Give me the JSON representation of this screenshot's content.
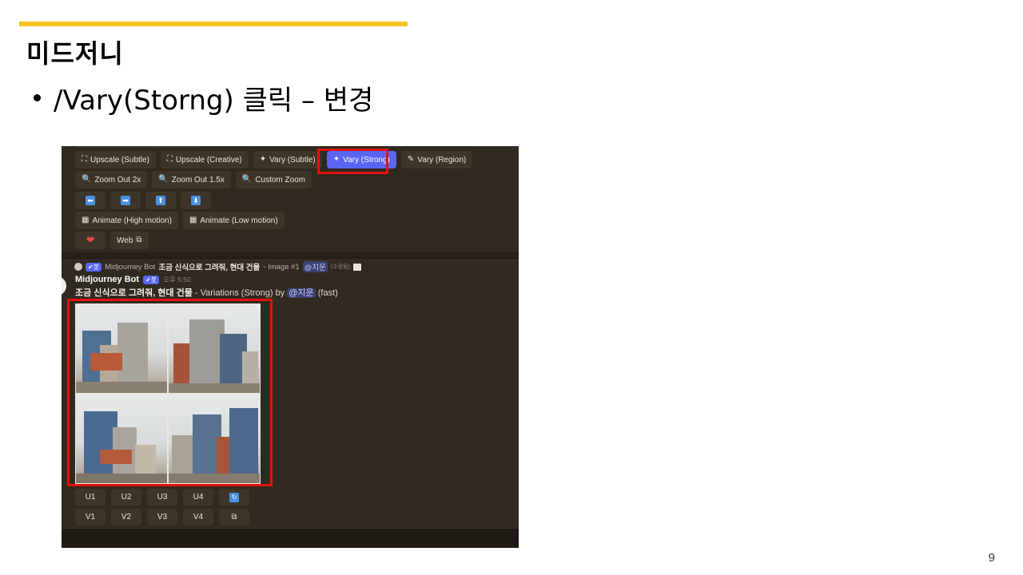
{
  "slide": {
    "title": "미드저니",
    "bullet": "/Vary(Storng) 클릭 – 변경",
    "page_number": "9",
    "accent_color": "#f7c51e"
  },
  "discord": {
    "action_buttons_row1": [
      {
        "icon": "expand-icon",
        "label": "Upscale (Subtle)"
      },
      {
        "icon": "expand-icon",
        "label": "Upscale (Creative)"
      },
      {
        "icon": "magic-wand-icon",
        "label": "Vary (Subtle)"
      },
      {
        "icon": "magic-wand-icon",
        "label": "Vary (Strong)",
        "highlighted": true
      },
      {
        "icon": "brush-icon",
        "label": "Vary (Region)"
      }
    ],
    "action_buttons_row2": [
      {
        "icon": "magnifier-icon",
        "label": "Zoom Out 2x"
      },
      {
        "icon": "magnifier-icon",
        "label": "Zoom Out 1.5x"
      },
      {
        "icon": "magnifier-icon",
        "label": "Custom Zoom"
      }
    ],
    "pan_buttons": [
      "⬅",
      "➡",
      "⬆",
      "⬇"
    ],
    "animate_buttons": [
      {
        "icon": "film-icon",
        "label": "Animate (High motion)"
      },
      {
        "icon": "film-icon",
        "label": "Animate (Low motion)"
      }
    ],
    "misc_buttons": {
      "heart": "❤",
      "web_label": "Web"
    },
    "reply_preview": {
      "bot_tag": "✔봇",
      "author": "Midjourney Bot",
      "prompt": "조금 신식으로 그려줘, 현대 건물",
      "suffix": "- Image #1",
      "mention": "@지운",
      "edited": "(수정됨)"
    },
    "message": {
      "author": "Midjourney Bot",
      "bot_tag": "✔봇",
      "timestamp": "오후 5:50",
      "prompt": "조금 신식으로 그려줘, 현대 건물",
      "detail": "- Variations (Strong) by",
      "mention": "@지운",
      "speed": "(fast)"
    },
    "upscale_buttons": [
      "U1",
      "U2",
      "U3",
      "U4"
    ],
    "variation_buttons": [
      "V1",
      "V2",
      "V3",
      "V4"
    ],
    "colors": {
      "background": "#312a20",
      "button": "#3d3529",
      "primary": "#5865f2",
      "highlight_box": "#e3120b"
    }
  }
}
